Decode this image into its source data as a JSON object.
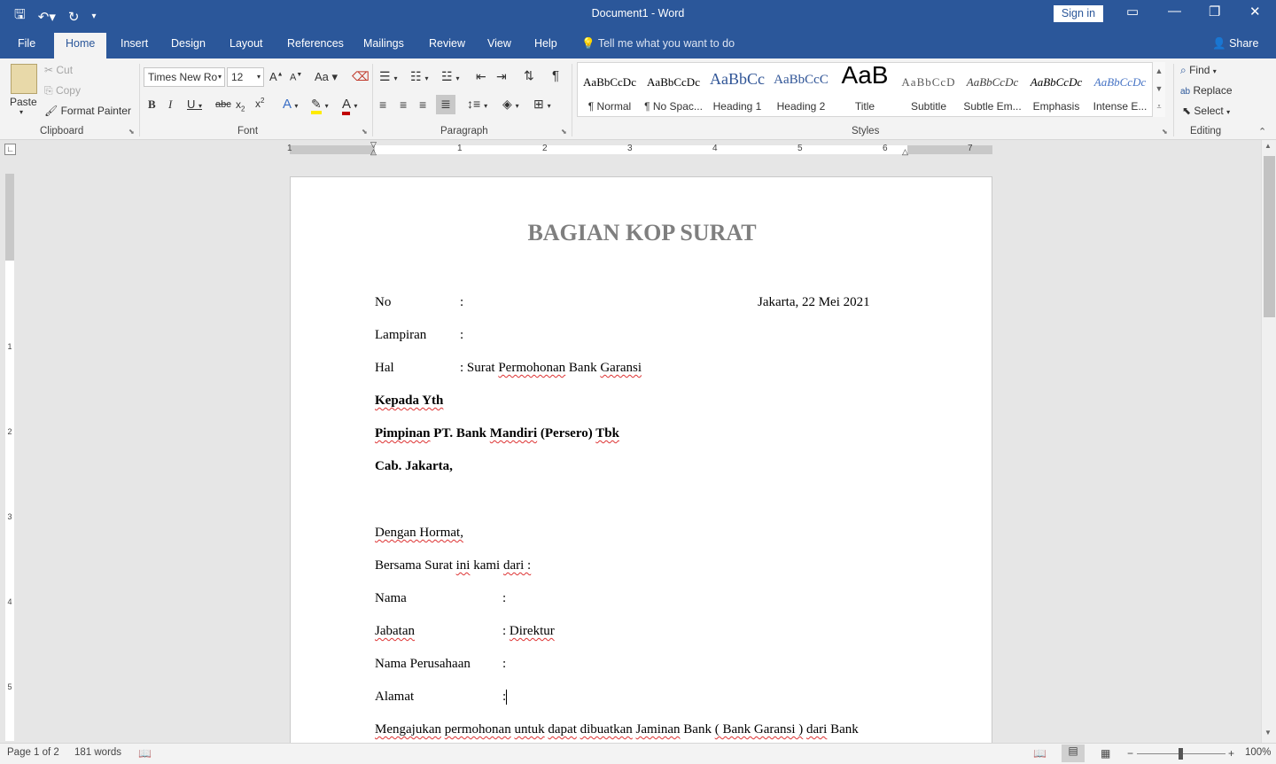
{
  "window": {
    "title": "Document1  -  Word",
    "sign_in": "Sign in"
  },
  "tabs": [
    "File",
    "Home",
    "Insert",
    "Design",
    "Layout",
    "References",
    "Mailings",
    "Review",
    "View",
    "Help"
  ],
  "tell_me": "Tell me what you want to do",
  "share": "Share",
  "clipboard": {
    "paste": "Paste",
    "cut": "Cut",
    "copy": "Copy",
    "format_painter": "Format Painter",
    "group": "Clipboard"
  },
  "font": {
    "name": "Times New Ro",
    "size": "12",
    "group": "Font"
  },
  "paragraph": {
    "group": "Paragraph"
  },
  "styles": {
    "group": "Styles",
    "items": [
      {
        "sample": "AaBbCcDc",
        "name": "¶ Normal"
      },
      {
        "sample": "AaBbCcDc",
        "name": "¶ No Spac..."
      },
      {
        "sample": "AaBbCc",
        "name": "Heading 1"
      },
      {
        "sample": "AaBbCcC",
        "name": "Heading 2"
      },
      {
        "sample": "AaB",
        "name": "Title"
      },
      {
        "sample": "AaBbCcD",
        "name": "Subtitle"
      },
      {
        "sample": "AaBbCcDc",
        "name": "Subtle Em..."
      },
      {
        "sample": "AaBbCcDc",
        "name": "Emphasis"
      },
      {
        "sample": "AaBbCcDc",
        "name": "Intense E..."
      }
    ]
  },
  "editing": {
    "find": "Find",
    "replace": "Replace",
    "select": "Select",
    "group": "Editing"
  },
  "ruler": {
    "h_numbers": [
      "1",
      "1",
      "2",
      "3",
      "4",
      "5",
      "6",
      "7"
    ],
    "v_numbers": [
      "1",
      "2",
      "3",
      "4",
      "5"
    ]
  },
  "document": {
    "heading": "BAGIAN KOP SURAT",
    "no_label": "No",
    "colon": ":",
    "date": "Jakarta, 22 Mei 2021",
    "lampiran": "Lampiran",
    "hal": "Hal",
    "hal_value_pre": ": Surat ",
    "hal_value_w1": "Permohonan",
    "hal_value_mid": " Bank ",
    "hal_value_w2": "Garansi",
    "kepada": "Kepada Yth",
    "pimpinan_w1": "Pimpinan",
    "pimpinan_mid": " PT. Bank ",
    "pimpinan_w2": "Mandiri",
    "pimpinan_mid2": " (Persero) ",
    "pimpinan_w3": "Tbk",
    "cabang": "Cab. Jakarta,",
    "hormat": "Dengan Hormat,",
    "bersama_pre": "Bersama Surat ",
    "bersama_w1": "ini",
    "bersama_mid": " kami ",
    "bersama_w2": "dari :",
    "nama": "Nama",
    "jabatan": "Jabatan",
    "jabatan_value": "Direktur",
    "perusahaan": "Nama Perusahaan",
    "alamat": "Alamat",
    "mengajukan_w1": "Mengajukan",
    "mengajukan_w2": "permohonan",
    "mengajukan_w3": "untuk",
    "mengajukan_w4": "dapat",
    "mengajukan_w5": "dibuatkan",
    "mengajukan_w6": "Jaminan",
    "mengajukan_bank": "Bank",
    "mengajukan_paren": "( Bank Garansi )",
    "mengajukan_w7": "dari",
    "mengajukan_end": "Bank"
  },
  "status": {
    "page": "Page 1 of 2",
    "words": "181 words",
    "zoom": "100%"
  }
}
